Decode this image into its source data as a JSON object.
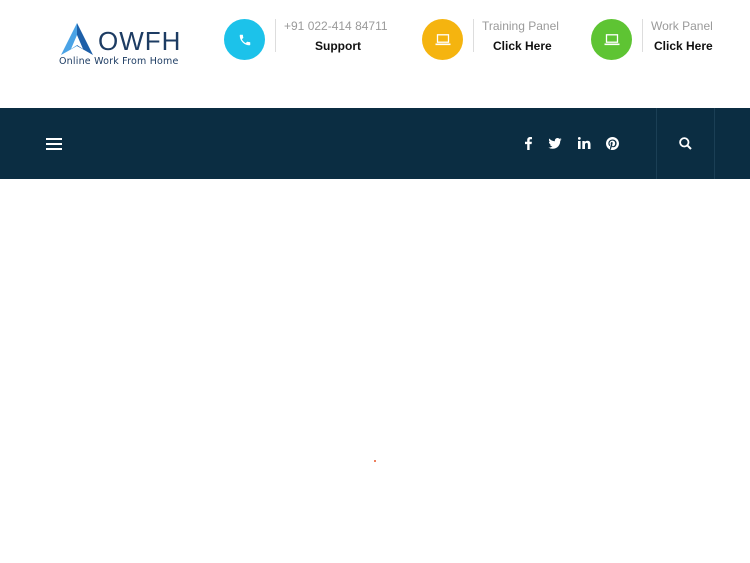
{
  "logo": {
    "brand": "OWFH",
    "tagline": "Online Work From Home",
    "colors": {
      "dark": "#1d5fa8",
      "light": "#4aa3e6"
    }
  },
  "header": {
    "support": {
      "icon": "phone-icon",
      "color": "#1cc2ea",
      "sub": "+91 022-414 84711",
      "main": "Support"
    },
    "training": {
      "icon": "laptop-icon",
      "color": "#f5b40f",
      "sub": "Training Panel",
      "main": "Click Here"
    },
    "work": {
      "icon": "laptop-icon",
      "color": "#5ec433",
      "sub": "Work Panel",
      "main": "Click Here"
    }
  },
  "navbar": {
    "background": "#0b2d42",
    "menu_icon": "hamburger-menu-icon",
    "social": [
      "facebook-icon",
      "twitter-icon",
      "linkedin-icon",
      "pinterest-icon"
    ],
    "search_icon": "search-icon"
  }
}
